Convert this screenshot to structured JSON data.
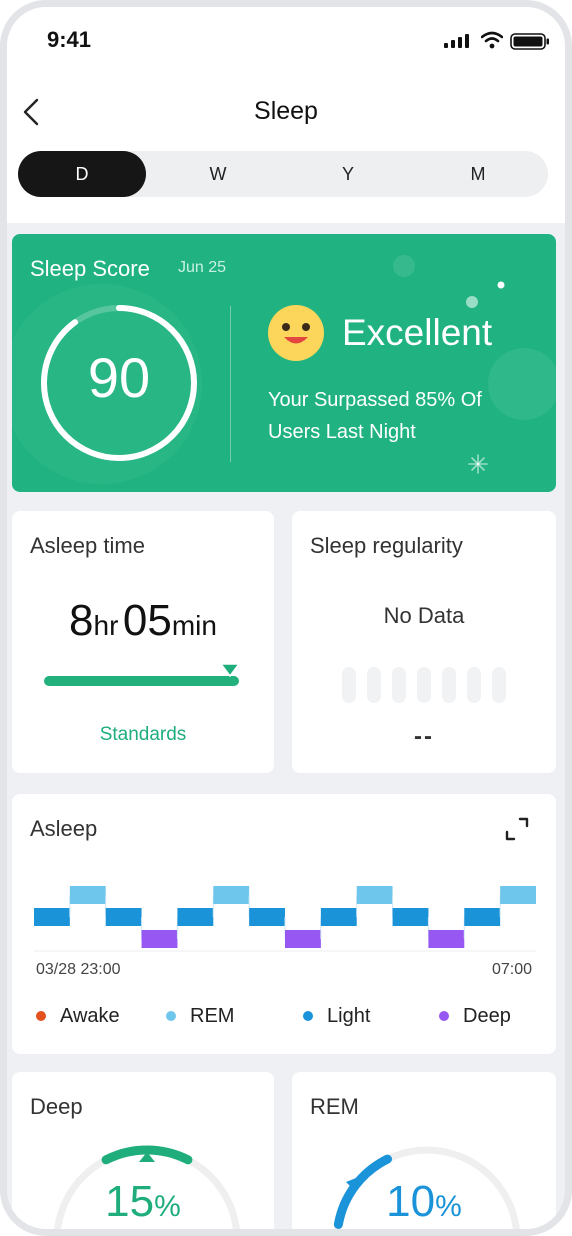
{
  "status_bar": {
    "time": "9:41"
  },
  "nav": {
    "title": "Sleep"
  },
  "period_tabs": [
    {
      "label": "D",
      "active": true
    },
    {
      "label": "W",
      "active": false
    },
    {
      "label": "Y",
      "active": false
    },
    {
      "label": "M",
      "active": false
    }
  ],
  "score_card": {
    "title": "Sleep Score",
    "date": "Jun 25",
    "score": "90",
    "score_fraction": 0.9,
    "rating": "Excellent",
    "message": "Your  Surpassed 85% Of Users Last Night",
    "color": "#20b381"
  },
  "asleep_time": {
    "title": "Asleep time",
    "hours": "8",
    "hours_unit": "hr",
    "minutes": "05",
    "minutes_unit": "min",
    "link_label": "Standards"
  },
  "sleep_regularity": {
    "title": "Sleep regularity",
    "status": "No Data",
    "value": "--"
  },
  "asleep_chart": {
    "title": "Asleep",
    "start_time": "03/28 23:00",
    "end_time": "07:00",
    "legend": [
      {
        "label": "Awake",
        "color": "#e2511e"
      },
      {
        "label": "REM",
        "color": "#6fc6ec"
      },
      {
        "label": "Light",
        "color": "#1b93d9"
      },
      {
        "label": "Deep",
        "color": "#9657f2"
      }
    ],
    "stages": [
      "Light",
      "REM",
      "Light",
      "Deep",
      "Light",
      "REM",
      "Light",
      "Deep",
      "Light",
      "REM",
      "Light",
      "Deep",
      "Light",
      "REM"
    ]
  },
  "deep_card": {
    "title": "Deep",
    "value": "15",
    "unit": "%",
    "fraction": 0.15,
    "color": "#1fae7b"
  },
  "rem_card": {
    "title": "REM",
    "value": "10",
    "unit": "%",
    "fraction": 0.1,
    "color": "#1b93d9"
  }
}
